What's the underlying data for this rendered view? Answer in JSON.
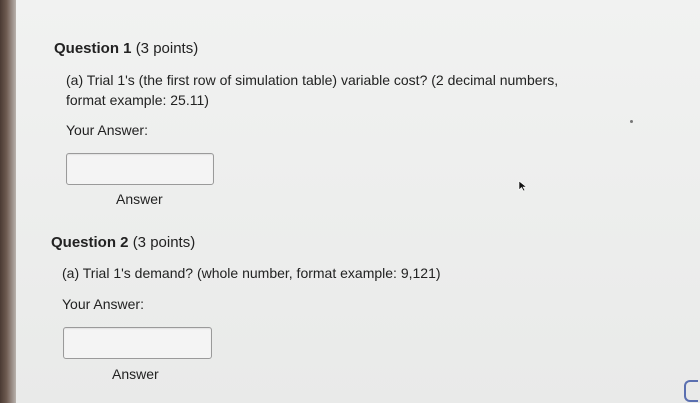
{
  "question1": {
    "title_num": "Question 1",
    "title_points": "(3 points)",
    "text_line1": "(a) Trial 1's (the first row of simulation table) variable cost? (2 decimal numbers,",
    "text_line2": "format example: 25.11)",
    "your_answer_label": "Your Answer:",
    "answer_value": "",
    "answer_button": "Answer"
  },
  "question2": {
    "title_num": "Question 2",
    "title_points": "(3 points)",
    "text_line1": "(a) Trial 1's demand? (whole number, format example: 9,121)",
    "your_answer_label": "Your Answer:",
    "answer_value": "",
    "answer_button": "Answer"
  },
  "icons": {
    "mouse_cursor": "mouse-cursor-icon",
    "corner_badge": "corner-badge-icon"
  }
}
